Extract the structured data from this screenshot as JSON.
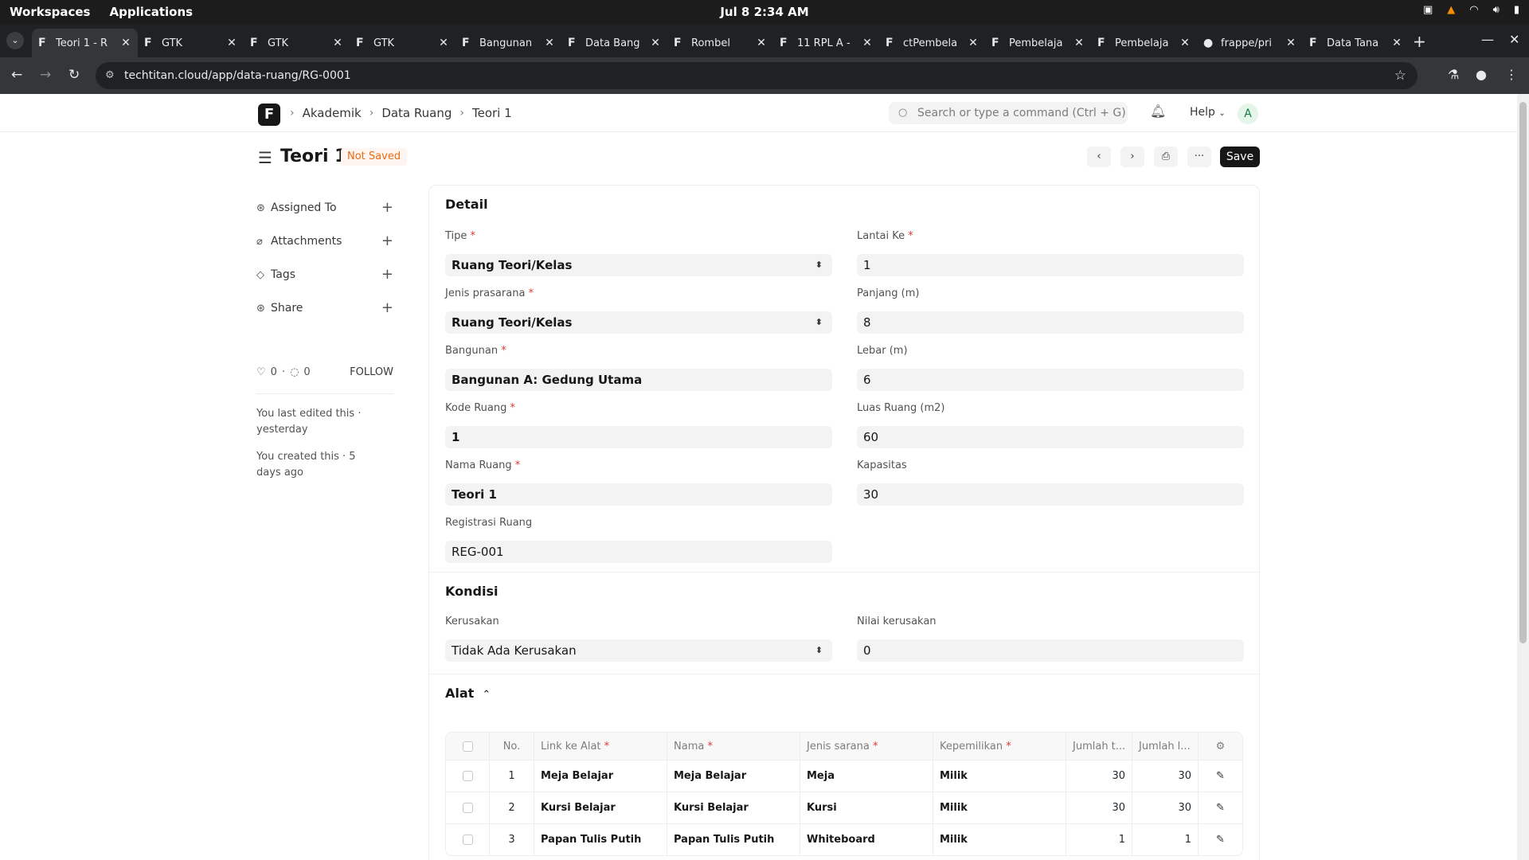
{
  "os": {
    "workspaces": "Workspaces",
    "applications": "Applications",
    "clock": "Jul 8  2:34 AM"
  },
  "tabs": [
    {
      "title": "Teori 1 - R",
      "icon": "frappe-icon",
      "active": true
    },
    {
      "title": "GTK",
      "icon": "frappe-icon"
    },
    {
      "title": "GTK",
      "icon": "frappe-icon"
    },
    {
      "title": "GTK",
      "icon": "frappe-icon"
    },
    {
      "title": "Bangunan",
      "icon": "frappe-icon"
    },
    {
      "title": "Data Bang",
      "icon": "frappe-icon"
    },
    {
      "title": "Rombel",
      "icon": "frappe-icon"
    },
    {
      "title": "11 RPL A -",
      "icon": "frappe-icon"
    },
    {
      "title": "ctPembela",
      "icon": "frappe-icon"
    },
    {
      "title": "Pembelaja",
      "icon": "frappe-icon"
    },
    {
      "title": "Pembelaja",
      "icon": "frappe-icon"
    },
    {
      "title": "frappe/pri",
      "icon": "github-icon"
    },
    {
      "title": "Data Tana",
      "icon": "frappe-icon"
    }
  ],
  "address": {
    "url": "techtitan.cloud/app/data-ruang/RG-0001"
  },
  "navbar": {
    "logo": "F",
    "breadcrumbs": [
      "Akademik",
      "Data Ruang",
      "Teori 1"
    ],
    "search_placeholder": "Search or type a command (Ctrl + G)",
    "help_label": "Help",
    "avatar_initial": "A"
  },
  "page": {
    "title": "Teori 1",
    "status": "Not Saved",
    "save_label": "Save",
    "more_label": "···"
  },
  "sidebar": {
    "items": [
      {
        "label": "Assigned To",
        "icon": "assign-icon"
      },
      {
        "label": "Attachments",
        "icon": "paperclip-icon"
      },
      {
        "label": "Tags",
        "icon": "tag-icon"
      },
      {
        "label": "Share",
        "icon": "share-icon"
      }
    ],
    "likes": "0",
    "comments": "0",
    "follow_label": "FOLLOW",
    "last_edited": "You last edited this · yesterday",
    "created": "You created this · 5 days ago"
  },
  "detail": {
    "section_title": "Detail",
    "fields": {
      "tipe": {
        "label": "Tipe",
        "value": "Ruang Teori/Kelas"
      },
      "jenis_prasarana": {
        "label": "Jenis prasarana",
        "value": "Ruang Teori/Kelas"
      },
      "bangunan": {
        "label": "Bangunan",
        "value": "Bangunan A: Gedung Utama"
      },
      "kode_ruang": {
        "label": "Kode Ruang",
        "value": "1"
      },
      "nama_ruang": {
        "label": "Nama Ruang",
        "value": "Teori 1"
      },
      "registrasi_ruang": {
        "label": "Registrasi Ruang",
        "value": "REG-001"
      },
      "lantai_ke": {
        "label": "Lantai Ke",
        "value": "1"
      },
      "panjang": {
        "label": "Panjang (m)",
        "value": "8"
      },
      "lebar": {
        "label": "Lebar (m)",
        "value": "6"
      },
      "luas_ruang": {
        "label": "Luas Ruang (m2)",
        "value": "60"
      },
      "kapasitas": {
        "label": "Kapasitas",
        "value": "30"
      }
    }
  },
  "kondisi": {
    "section_title": "Kondisi",
    "kerusakan": {
      "label": "Kerusakan",
      "value": "Tidak Ada Kerusakan"
    },
    "nilai_kerusakan": {
      "label": "Nilai kerusakan",
      "value": "0"
    }
  },
  "alat": {
    "section_title": "Alat",
    "columns": {
      "no": "No.",
      "link_ke_alat": "Link ke Alat",
      "nama": "Nama",
      "jenis_sarana": "Jenis sarana",
      "kepemilikan": "Kepemilikan",
      "jumlah_t": "Jumlah t...",
      "jumlah_l": "Jumlah l..."
    },
    "rows": [
      {
        "no": "1",
        "link": "Meja Belajar",
        "nama": "Meja Belajar",
        "jenis": "Meja",
        "kepemilikan": "Milik",
        "jumlah_t": "30",
        "jumlah_l": "30"
      },
      {
        "no": "2",
        "link": "Kursi Belajar",
        "nama": "Kursi Belajar",
        "jenis": "Kursi",
        "kepemilikan": "Milik",
        "jumlah_t": "30",
        "jumlah_l": "30"
      },
      {
        "no": "3",
        "link": "Papan Tulis Putih",
        "nama": "Papan Tulis Putih",
        "jenis": "Whiteboard",
        "kepemilikan": "Milik",
        "jumlah_t": "1",
        "jumlah_l": "1"
      }
    ]
  },
  "colors": {
    "primary": "#171717",
    "indicator_orange": "#e86c13",
    "required_red": "#e03636"
  }
}
